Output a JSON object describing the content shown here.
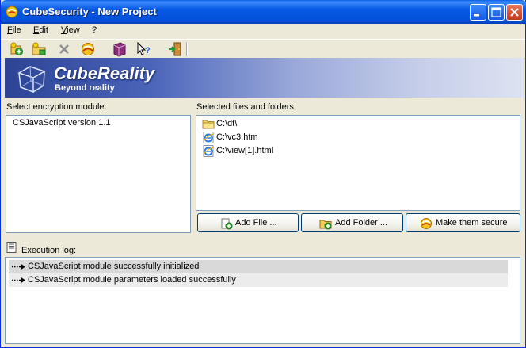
{
  "window": {
    "title": "CubeSecurity - New Project"
  },
  "menu": {
    "items": [
      "File",
      "Edit",
      "View",
      "?"
    ],
    "underlines": [
      "F",
      "E",
      "V",
      ""
    ]
  },
  "toolbar": {
    "icons": [
      "new-project-icon",
      "open-project-icon",
      "delete-icon",
      "secure-icon",
      "help-book-icon",
      "whats-this-icon",
      "exit-icon"
    ]
  },
  "banner": {
    "brand": "CubeReality",
    "slogan": "Beyond reality"
  },
  "encryption": {
    "label": "Select encryption module:",
    "modules": [
      "CSJavaScript version 1.1"
    ]
  },
  "files": {
    "label": "Selected files and folders:",
    "items": [
      {
        "name": "C:\\dt\\",
        "icon": "folder-icon"
      },
      {
        "name": "C:\\vc3.htm",
        "icon": "ie-document-icon"
      },
      {
        "name": "C:\\view[1].html",
        "icon": "ie-document-icon"
      }
    ]
  },
  "buttons": {
    "add_file": "Add File ...",
    "add_folder": "Add Folder ...",
    "secure": "Make them secure"
  },
  "log": {
    "label": "Execution log:",
    "entries": [
      "CSJavaScript module successfully initialized",
      "CSJavaScript module parameters loaded successfully"
    ]
  },
  "colors": {
    "title_bar": "#0351d8",
    "window_bg": "#ece9d8",
    "list_border": "#7f9db9",
    "log_row_bg": "#dcdcdc"
  }
}
